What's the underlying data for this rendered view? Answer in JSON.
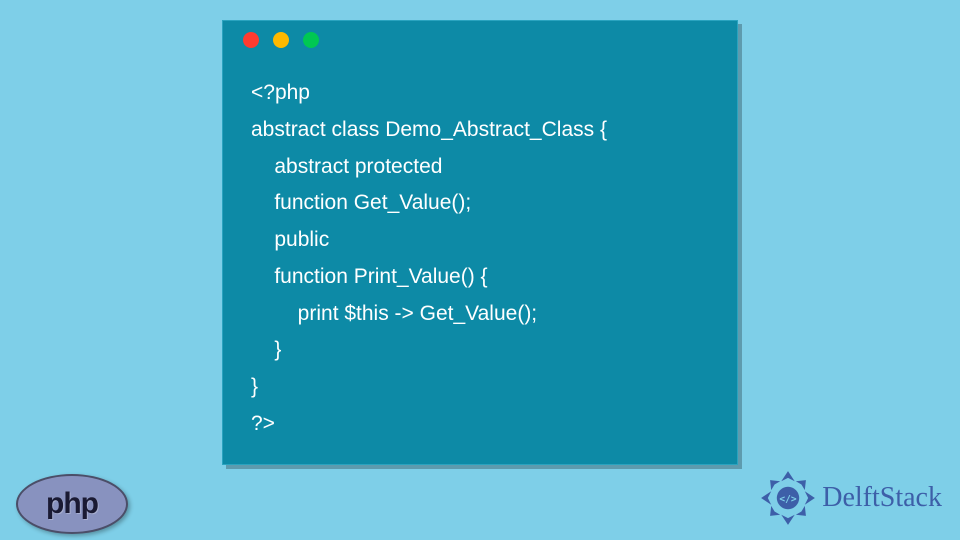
{
  "code": {
    "lines": [
      "<?php",
      "abstract class Demo_Abstract_Class {",
      "    abstract protected",
      "    function Get_Value();",
      "    public",
      "    function Print_Value() {",
      "        print $this -> Get_Value();",
      "    }",
      "}",
      "?>"
    ]
  },
  "php_badge": {
    "label": "php"
  },
  "brand": {
    "name": "DelftStack"
  },
  "window_dots": {
    "red": "#ff3b30",
    "yellow": "#ffb900",
    "green": "#00c853"
  }
}
